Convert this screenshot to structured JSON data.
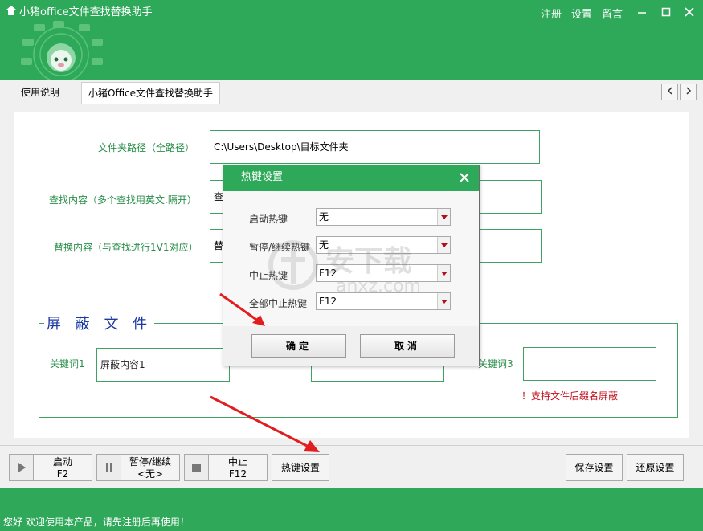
{
  "app": {
    "title": "小猪office文件查找替换助手",
    "top_links": [
      "注册",
      "设置",
      "留言"
    ]
  },
  "tabs": [
    {
      "label": "使用说明"
    },
    {
      "label": "小猪Office文件查找替换助手"
    }
  ],
  "form": {
    "folder_label": "文件夹路径（全路径）",
    "folder_value": "C:\\Users\\Desktop\\目标文件夹",
    "find_label": "查找内容（多个查找用英文.隔开）",
    "find_value": "查",
    "replace_label": "替换内容（与查找进行1V1对应）",
    "replace_value": "替"
  },
  "shield_group": {
    "title": "屏 蔽 文 件",
    "kw1_label": "关键词1",
    "kw1_value": "屏蔽内容1",
    "kw3_label": "关键词3",
    "note": "！支持文件后缀名屏蔽"
  },
  "controls": {
    "start": {
      "label": "启动",
      "hotkey": "F2"
    },
    "pause": {
      "label": "暂停/继续",
      "hotkey": "<无>"
    },
    "stop": {
      "label": "中止",
      "hotkey": "F12"
    },
    "hotkey_settings": "热键设置",
    "save_settings": "保存设置",
    "restore_settings": "还原设置"
  },
  "status": {
    "text": "您好 欢迎使用本产品，请先注册后再使用！"
  },
  "dialog": {
    "title": "热键设置",
    "rows": [
      {
        "label": "启动热键",
        "value": "无"
      },
      {
        "label": "暂停/继续热键",
        "value": "无"
      },
      {
        "label": "中止热键",
        "value": "F12"
      },
      {
        "label": "全部中止热键",
        "value": "F12"
      }
    ],
    "ok": "确定",
    "cancel": "取消"
  },
  "colors": {
    "brand_green": "#2ea859",
    "accent_red": "#c0121c",
    "group_title_blue": "#1b3aa3"
  }
}
